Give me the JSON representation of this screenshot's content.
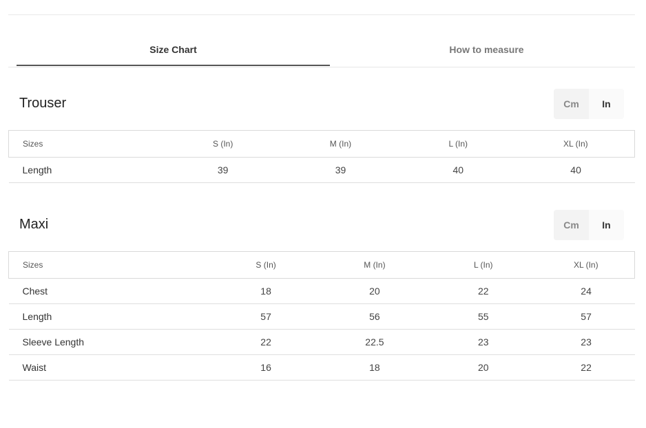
{
  "tabs": [
    {
      "label": "Size Chart",
      "active": true
    },
    {
      "label": "How to measure",
      "active": false
    }
  ],
  "units": {
    "cm": "Cm",
    "in": "In",
    "selected": "In"
  },
  "sections": [
    {
      "title": "Trouser",
      "headers": [
        "Sizes",
        "S (In)",
        "M (In)",
        "L (In)",
        "XL (In)"
      ],
      "rows": [
        [
          "Length",
          "39",
          "39",
          "40",
          "40"
        ]
      ]
    },
    {
      "title": "Maxi",
      "headers": [
        "Sizes",
        "S (In)",
        "M (In)",
        "L (In)",
        "XL (In)"
      ],
      "rows": [
        [
          "Chest",
          "18",
          "20",
          "22",
          "24"
        ],
        [
          "Length",
          "57",
          "56",
          "55",
          "57"
        ],
        [
          "Sleeve Length",
          "22",
          "22.5",
          "23",
          "23"
        ],
        [
          "Waist",
          "16",
          "18",
          "20",
          "22"
        ]
      ]
    }
  ]
}
